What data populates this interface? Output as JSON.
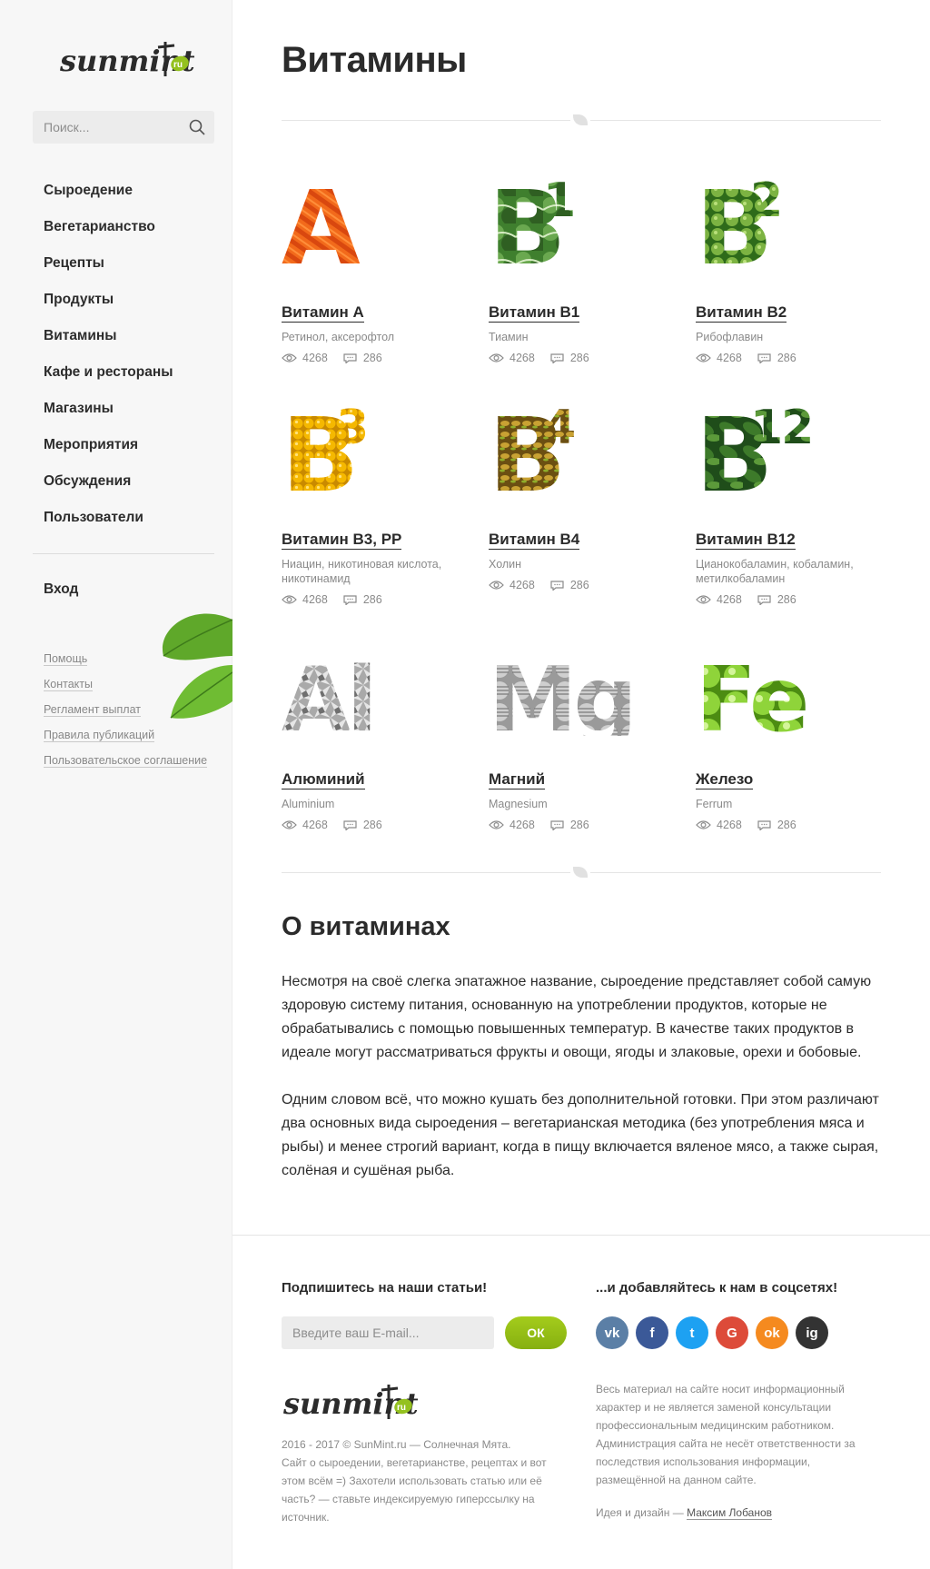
{
  "sidebar": {
    "search_placeholder": "Поиск...",
    "nav": [
      "Сыроедение",
      "Вегетарианство",
      "Рецепты",
      "Продукты",
      "Витамины",
      "Кафе и рестораны",
      "Магазины",
      "Мероприятия",
      "Обсуждения",
      "Пользователи"
    ],
    "login": "Вход",
    "links": [
      "Помощь",
      "Контакты",
      "Регламент выплат",
      "Правила публикаций",
      "Пользовательское соглашение"
    ]
  },
  "logo": {
    "text": "sunmint",
    "badge": "ru"
  },
  "page": {
    "title": "Витамины"
  },
  "cards": [
    {
      "glyph": "A",
      "sup": "",
      "name": "Витамин А",
      "sub": "Ретинол, аксерофтол",
      "views": "4268",
      "comments": "286"
    },
    {
      "glyph": "B",
      "sup": "1",
      "name": "Витамин В1",
      "sub": "Тиамин",
      "views": "4268",
      "comments": "286"
    },
    {
      "glyph": "B",
      "sup": "2",
      "name": "Витамин В2",
      "sub": "Рибофлавин",
      "views": "4268",
      "comments": "286"
    },
    {
      "glyph": "B",
      "sup": "3",
      "name": "Витамин В3, РР",
      "sub": "Ниацин, никотиновая кислота, никотинамид",
      "views": "4268",
      "comments": "286"
    },
    {
      "glyph": "B",
      "sup": "4",
      "name": "Витамин В4",
      "sub": "Холин",
      "views": "4268",
      "comments": "286"
    },
    {
      "glyph": "B",
      "sup": "12",
      "name": "Витамин В12",
      "sub": "Цианокобаламин, кобаламин, метилкобаламин",
      "views": "4268",
      "comments": "286"
    },
    {
      "glyph": "Al",
      "sup": "",
      "name": "Алюминий",
      "sub": "Aluminium",
      "views": "4268",
      "comments": "286"
    },
    {
      "glyph": "Mg",
      "sup": "",
      "name": "Магний",
      "sub": "Magnesium",
      "views": "4268",
      "comments": "286"
    },
    {
      "glyph": "Fe",
      "sup": "",
      "name": "Железо",
      "sub": "Ferrum",
      "views": "4268",
      "comments": "286"
    }
  ],
  "about": {
    "title": "О витаминах",
    "p1": "Несмотря на своё слегка эпатажное название, сыроедение представляет собой самую здоровую систему питания, основанную на употреблении продуктов, которые не обрабатывались с помощью повышенных температур. В качестве таких продуктов в идеале могут рассматриваться фрукты и овощи, ягоды и злаковые, орехи и бобовые.",
    "p2": "Одним словом всё, что можно кушать без дополнительной готовки. При этом различают два основных вида сыроедения – вегетарианская методика (без употребления мяса и рыбы) и менее строгий вариант, когда в пищу включается вяленое мясо, а также сырая, солёная и сушёная рыба."
  },
  "footer": {
    "subscribe_title": "Подпишитесь на наши статьи!",
    "email_placeholder": "Введите ваш E-mail...",
    "ok_label": "ОК",
    "social_title": "...и добавляйтесь к нам в соцсетях!",
    "socials": [
      {
        "name": "vk",
        "glyph": "vk",
        "color": "#5b7fa6"
      },
      {
        "name": "facebook",
        "glyph": "f",
        "color": "#3b5998"
      },
      {
        "name": "twitter",
        "glyph": "t",
        "color": "#1da1f2"
      },
      {
        "name": "google",
        "glyph": "G",
        "color": "#dd4b39"
      },
      {
        "name": "odnoklassniki",
        "glyph": "ok",
        "color": "#f58a1f"
      },
      {
        "name": "instagram",
        "glyph": "ig",
        "color": "#333333"
      }
    ],
    "copyright_lines": [
      "2016 - 2017 © SunMint.ru — Солнечная Мята.",
      "Сайт о сыроедении, вегетарианстве, рецептах и вот",
      "этом всём =) Захотели использовать статью или её",
      "часть? — ставьте индексируемую гиперссылку на",
      "источник."
    ],
    "disclaimer_lines": [
      "Весь материал на сайте носит информационный",
      "характер и не является заменой консультации",
      "профессиональным медицинским работником.",
      "Администрация сайта не несёт ответственности за",
      "последствия использования информации,",
      "размещённой на данном сайте."
    ],
    "credits_prefix": "Идея и дизайн —",
    "credits_author": "Максим Лобанов"
  },
  "colors": {
    "accent_green": "#94c11f",
    "text_dark": "#2b2b2b",
    "text_muted": "#8a8a8a"
  }
}
